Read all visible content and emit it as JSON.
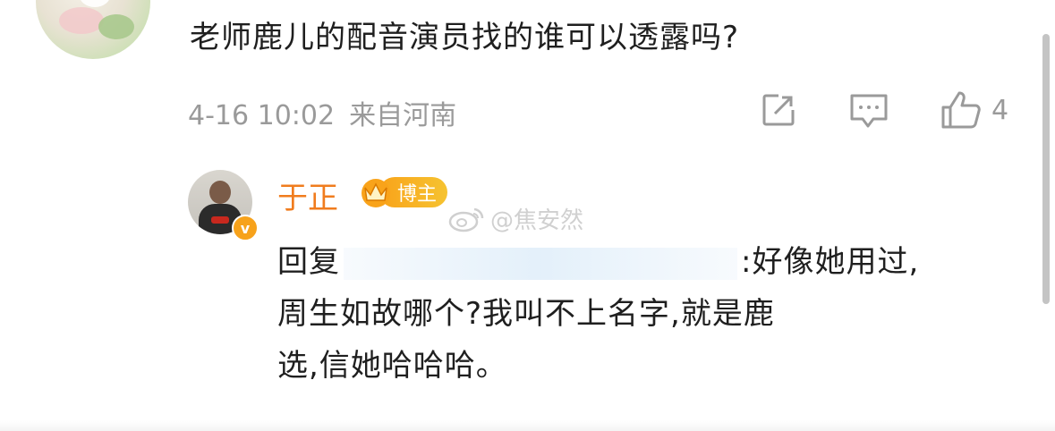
{
  "comment": {
    "text": "老师鹿儿的配音演员找的谁可以透露吗?",
    "date": "4-16 10:02",
    "location": "来自河南",
    "like_count": "4"
  },
  "reply": {
    "author": "于正",
    "badge": "博主",
    "verified_mark": "v",
    "prefix": "回复",
    "line1_suffix": ":好像她用过,",
    "line2": "周生如故哪个?我叫不上名字,就是鹿",
    "line3": "选,信她哈哈哈。"
  },
  "watermark": {
    "text": "@焦安然"
  },
  "icons": {
    "share": "share-icon",
    "reply": "comment-icon",
    "like": "thumbs-up-icon"
  },
  "colors": {
    "username": "#f07c1e",
    "meta": "#9a9a9a",
    "badge": "#f9a31a"
  }
}
